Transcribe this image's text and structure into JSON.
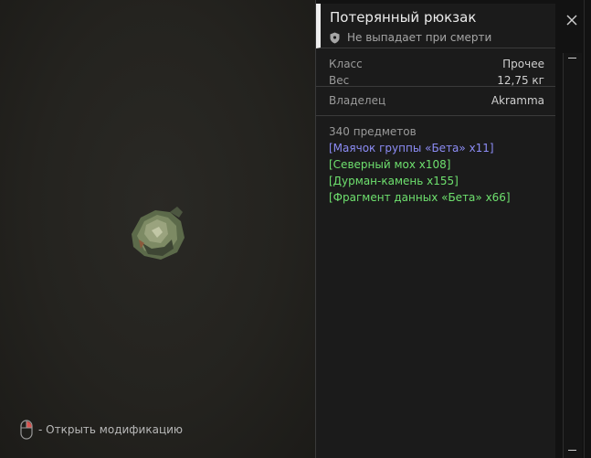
{
  "viewport": {
    "hint_text": "- Открыть модификацию"
  },
  "panel": {
    "title": "Потерянный рюкзак",
    "subtitle": "Не выпадает при смерти",
    "stats": [
      {
        "label": "Класс",
        "value": "Прочее"
      },
      {
        "label": "Вес",
        "value": "12,75 кг"
      }
    ],
    "owner": {
      "label": "Владелец",
      "value": "Akramma"
    },
    "contents_count": "340 предметов",
    "items": [
      {
        "text": "[Маячок группы «Бета» x11]",
        "color": "#8c8cf5"
      },
      {
        "text": "[Северный мох x108]",
        "color": "#6ee06e"
      },
      {
        "text": "[Дурман-камень x155]",
        "color": "#6ee06e"
      },
      {
        "text": "[Фрагмент данных «Бета» x66]",
        "color": "#6ee06e"
      }
    ]
  },
  "icons": {
    "close": "close-icon",
    "shield": "shield-icon",
    "mouse": "mouse-icon"
  },
  "colors": {
    "accent_bar": "#efefef",
    "rare_item": "#8c8cf5",
    "common_item": "#6ee06e"
  }
}
